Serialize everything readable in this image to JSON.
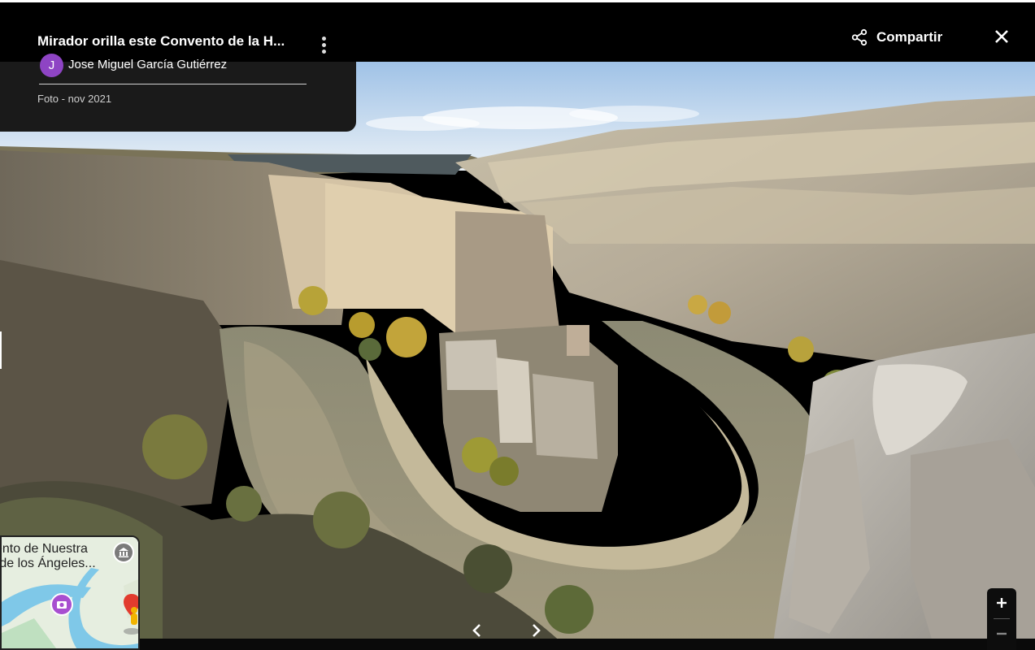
{
  "viewer": {
    "title": "Mirador orilla este Convento de la H...",
    "share_label": "Compartir",
    "author_initial": "J",
    "author_name": "Jose Miguel García Gutiérrez",
    "photo_date": "Foto - nov 2021"
  },
  "minimap": {
    "label_line1": "vento de Nuestra",
    "label_line2": "a de los Ángeles..."
  },
  "icons": {
    "share": "share-icon",
    "close": "close-icon",
    "more": "more-vert-icon",
    "prev": "chevron-left-icon",
    "next": "chevron-right-icon",
    "zoom_in": "plus-icon",
    "zoom_out": "minus-icon",
    "museum": "museum-icon",
    "camera": "camera-icon",
    "pegman": "pegman-icon"
  },
  "colors": {
    "topbar": "#000000",
    "panel": "#1a1a1a",
    "avatar": "#8e44c4",
    "river": "#8f8a70",
    "rock": "#b9b1a2",
    "sky": "#cfe0f2"
  }
}
